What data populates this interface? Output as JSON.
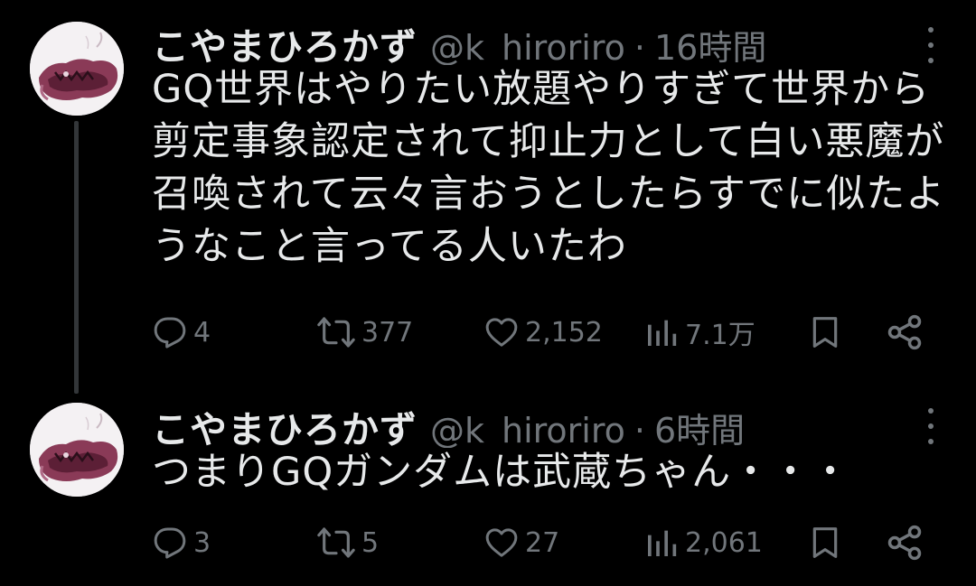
{
  "tweets": [
    {
      "display_name": "こやまひろかず",
      "handle": "@k_hiroriro",
      "separator": "·",
      "time": "16時間",
      "text": "GQ世界はやりたい放題やりすぎて世界から剪定事象認定されて抑止力として白い悪魔が召喚されて云々言おうとしたらすでに似たようなこと言ってる人いたわ",
      "stats": {
        "replies": "4",
        "retweets": "377",
        "likes": "2,152",
        "views": "7.1万"
      }
    },
    {
      "display_name": "こやまひろかず",
      "handle": "@k_hiroriro",
      "separator": "·",
      "time": "6時間",
      "text": "つまりGQガンダムは武蔵ちゃん・・・",
      "stats": {
        "replies": "3",
        "retweets": "5",
        "likes": "27",
        "views": "2,061"
      }
    }
  ],
  "icons": {
    "reply": "reply-icon",
    "retweet": "retweet-icon",
    "like": "heart-icon",
    "views": "views-icon",
    "bookmark": "bookmark-icon",
    "share": "share-icon",
    "more": "more-icon"
  },
  "colors": {
    "background": "#000000",
    "primary_text": "#e7e9ea",
    "secondary_text": "#71767b",
    "thread_line": "#333639"
  }
}
